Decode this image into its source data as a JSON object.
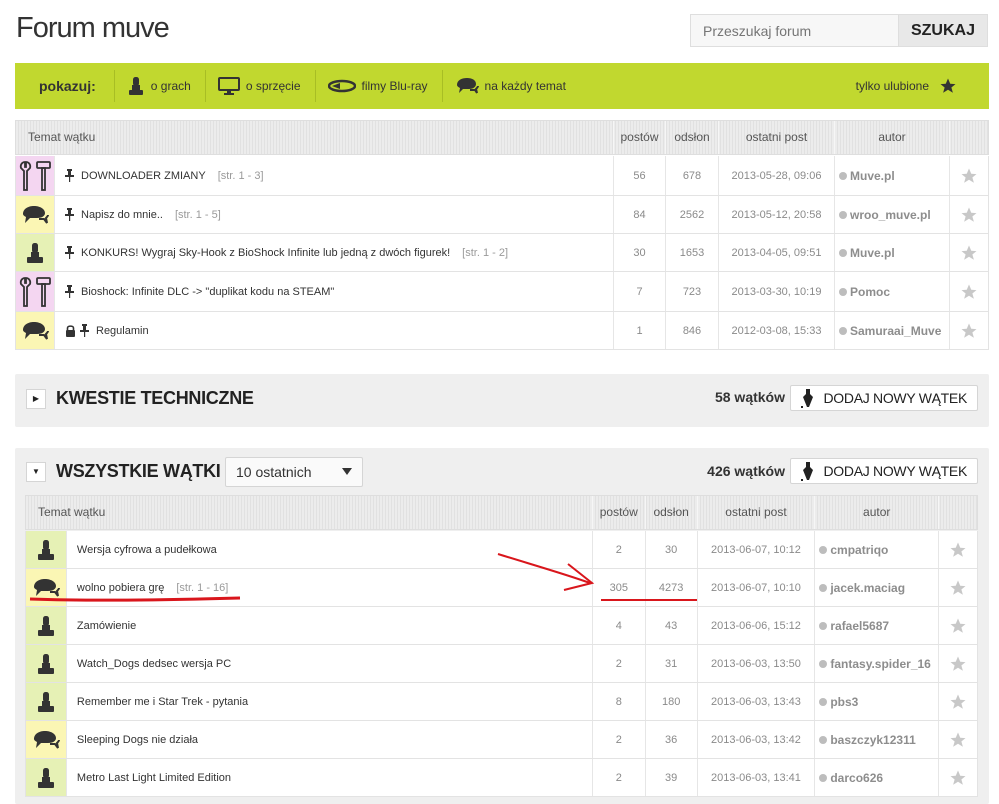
{
  "header": {
    "title": "Forum muve",
    "search_placeholder": "Przeszukaj forum",
    "search_button": "SZUKAJ"
  },
  "filter_bar": {
    "label": "pokazuj:",
    "items": [
      {
        "label": "o grach",
        "icon": "joystick-icon"
      },
      {
        "label": "o sprzęcie",
        "icon": "monitor-icon"
      },
      {
        "label": "filmy Blu-ray",
        "icon": "bluray-icon"
      },
      {
        "label": "na każdy temat",
        "icon": "chat-bubbles-icon"
      }
    ],
    "favorites_label": "tylko ulubione"
  },
  "table_headers": {
    "topic": "Temat wątku",
    "posts": "postów",
    "views": "odsłon",
    "last_post": "ostatni post",
    "author": "autor"
  },
  "pinned_threads": [
    {
      "category": "tools",
      "title": "DOWNLOADER ZMIANY",
      "pages": "[str. 1 - 3]",
      "posts": "56",
      "views": "678",
      "last_post": "2013-05-28, 09:06",
      "author": "Muve.pl",
      "locked": false
    },
    {
      "category": "chat",
      "title": "Napisz do mnie..",
      "pages": "[str. 1 - 5]",
      "posts": "84",
      "views": "2562",
      "last_post": "2013-05-12, 20:58",
      "author": "wroo_muve.pl",
      "locked": false
    },
    {
      "category": "games",
      "title": "KONKURS! Wygraj Sky-Hook z BioShock Infinite lub jedną z dwóch figurek!",
      "pages": "[str. 1 - 2]",
      "posts": "30",
      "views": "1653",
      "last_post": "2013-04-05, 09:51",
      "author": "Muve.pl",
      "locked": false
    },
    {
      "category": "tools",
      "title": "Bioshock: Infinite DLC -> \"duplikat kodu na STEAM\"",
      "pages": "",
      "posts": "7",
      "views": "723",
      "last_post": "2013-03-30, 10:19",
      "author": "Pomoc",
      "locked": false
    },
    {
      "category": "chat",
      "title": "Regulamin",
      "pages": "",
      "posts": "1",
      "views": "846",
      "last_post": "2012-03-08, 15:33",
      "author": "Samuraai_Muve",
      "locked": true
    }
  ],
  "section_tech": {
    "title": "KWESTIE TECHNICZNE",
    "count": "58 wątków",
    "add_button": "DODAJ NOWY WĄTEK"
  },
  "section_all": {
    "title": "WSZYSTKIE WĄTKI",
    "select_value": "10 ostatnich",
    "count": "426 wątków",
    "add_button": "DODAJ NOWY WĄTEK"
  },
  "all_threads": [
    {
      "category": "games",
      "title": "Wersja cyfrowa a pudełkowa",
      "pages": "",
      "posts": "2",
      "views": "30",
      "last_post": "2013-06-07, 10:12",
      "author": "cmpatriqo"
    },
    {
      "category": "chat",
      "title": "wolno pobiera grę",
      "pages": "[str. 1 - 16]",
      "posts": "305",
      "views": "4273",
      "last_post": "2013-06-07, 10:10",
      "author": "jacek.maciag"
    },
    {
      "category": "games",
      "title": "Zamówienie",
      "pages": "",
      "posts": "4",
      "views": "43",
      "last_post": "2013-06-06, 15:12",
      "author": "rafael5687"
    },
    {
      "category": "games",
      "title": "Watch_Dogs dedsec wersja PC",
      "pages": "",
      "posts": "2",
      "views": "31",
      "last_post": "2013-06-03, 13:50",
      "author": "fantasy.spider_16"
    },
    {
      "category": "games",
      "title": "Remember me i Star Trek - pytania",
      "pages": "",
      "posts": "8",
      "views": "180",
      "last_post": "2013-06-03, 13:43",
      "author": "pbs3"
    },
    {
      "category": "chat",
      "title": "Sleeping Dogs nie działa",
      "pages": "",
      "posts": "2",
      "views": "36",
      "last_post": "2013-06-03, 13:42",
      "author": "baszczyk12311"
    },
    {
      "category": "games",
      "title": "Metro Last Light Limited Edition",
      "pages": "",
      "posts": "2",
      "views": "39",
      "last_post": "2013-06-03, 13:41",
      "author": "darco626"
    }
  ],
  "colors": {
    "accent_green": "#c1d82f",
    "annotation_red": "#d9161c"
  }
}
